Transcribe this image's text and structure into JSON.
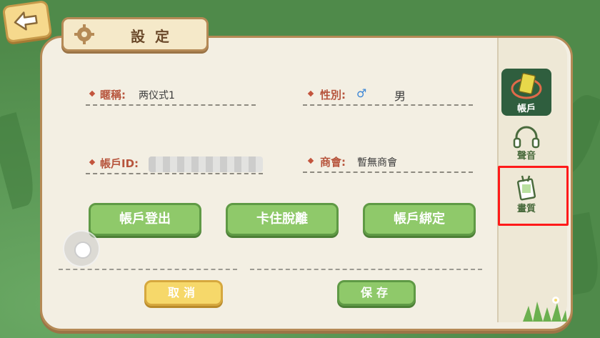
{
  "header": {
    "title": "設定"
  },
  "account": {
    "nickname_label": "暱稱:",
    "nickname_value": "两仪式1",
    "gender_label": "性別:",
    "gender_symbol": "♂",
    "gender_value": "男",
    "account_id_label": "帳戶ID:",
    "guild_label": "商會:",
    "guild_value": "暫無商會"
  },
  "buttons": {
    "logout": "帳戶登出",
    "unstuck": "卡住脫離",
    "bind": "帳戶綁定",
    "cancel": "取消",
    "save": "保存"
  },
  "side_tabs": [
    {
      "label": "帳戶",
      "icon": "account-book-icon",
      "active": true
    },
    {
      "label": "聲音",
      "icon": "headphones-icon",
      "active": false
    },
    {
      "label": "畫質",
      "icon": "quality-card-icon",
      "active": false
    }
  ],
  "colors": {
    "highlight": "#ff1a1a",
    "green_button": "#8fc96a",
    "yellow_button": "#f6d86a",
    "label_red": "#b7553d"
  }
}
